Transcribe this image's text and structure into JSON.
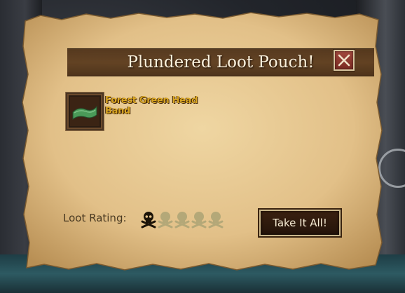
{
  "window": {
    "title": "Plundered Loot Pouch!",
    "close_icon": "close-x-icon"
  },
  "loot": {
    "items": [
      {
        "name": "Forest Green Head Band",
        "icon": "green-head-band-icon",
        "name_color": "#d9a623"
      }
    ]
  },
  "rating": {
    "label": "Loot Rating:",
    "value": 1,
    "max": 5,
    "icon": "skull-and-crossbones-icon"
  },
  "actions": {
    "take_all_label": "Take It All!"
  },
  "colors": {
    "parchment": "#e6c98f",
    "title_bar": "#5c3c1e",
    "close_button": "#8a3026",
    "skull_active": "#1c1408",
    "skull_inactive": "#b4a878"
  }
}
